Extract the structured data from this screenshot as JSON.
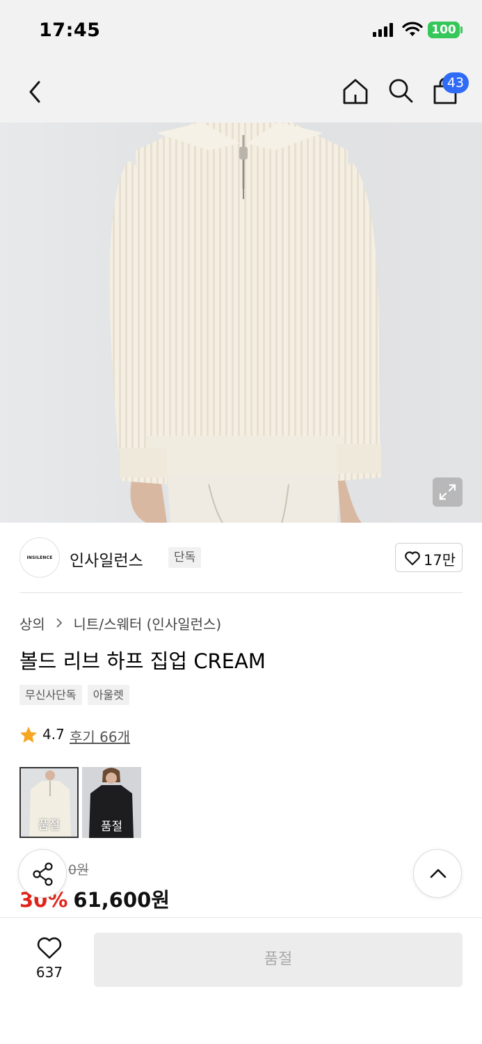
{
  "status_bar": {
    "time": "17:45",
    "battery": "100"
  },
  "nav": {
    "cart_count": "43"
  },
  "brand": {
    "logo_text": "INSILENCE",
    "name": "인사일런스",
    "tag": "단독",
    "likes": "17만"
  },
  "breadcrumb": {
    "category": "상의",
    "subcategory": "니트/스웨터 (인사일런스)"
  },
  "product": {
    "title": "볼드 리브 하프 집업 CREAM",
    "tags": [
      "무신사단독",
      "아울렛"
    ],
    "rating": "4.7",
    "reviews": "후기 66개"
  },
  "thumbnails": [
    {
      "label": "품절",
      "color": "cream"
    },
    {
      "label": "품절",
      "color": "black"
    }
  ],
  "price": {
    "original_visible": "0원",
    "discount": "30%",
    "sale": "61,600원"
  },
  "bottom": {
    "wish_count": "637",
    "buy_label": "품절"
  },
  "colors": {
    "accent": "#2f6bf5",
    "discount": "#e0241b",
    "battery": "#35c759",
    "star": "#f5a623"
  }
}
